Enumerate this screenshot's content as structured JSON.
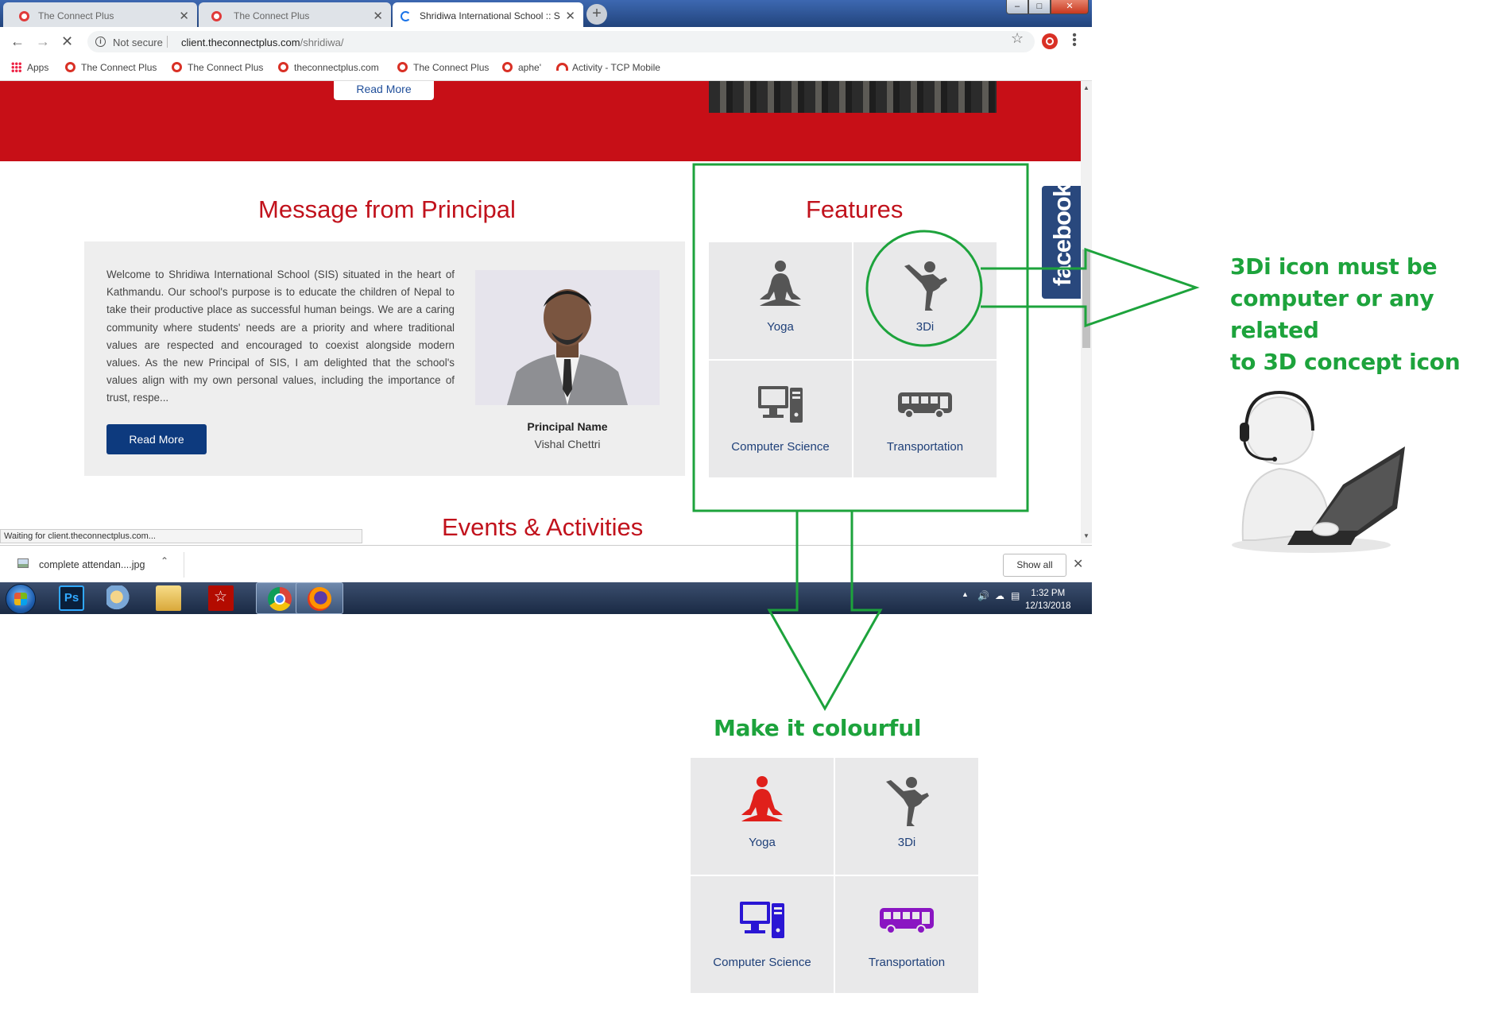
{
  "browser": {
    "tabs": [
      {
        "title": "The Connect Plus",
        "active": false
      },
      {
        "title": "The Connect Plus",
        "active": false
      },
      {
        "title": "Shridiwa International School :: S",
        "active": true
      }
    ],
    "address": {
      "security": "Not secure",
      "url_host": "client.theconnectplus.com",
      "url_path": "/shridiwa/"
    },
    "bookmarks": [
      {
        "label": "Apps",
        "icon": "apps-grid-icon"
      },
      {
        "label": "The Connect Plus",
        "icon": "connectplus-favicon"
      },
      {
        "label": "The Connect Plus",
        "icon": "connectplus-favicon"
      },
      {
        "label": "theconnectplus.com",
        "icon": "connectplus-favicon"
      },
      {
        "label": "The Connect Plus",
        "icon": "connectplus-favicon"
      },
      {
        "label": "aphe'",
        "icon": "connectplus-favicon"
      },
      {
        "label": "Activity - TCP Mobile",
        "icon": "tcp-mobile-icon"
      }
    ],
    "status": "Waiting for client.theconnectplus.com...",
    "download": {
      "file": "complete attendan....jpg",
      "show_all": "Show all"
    }
  },
  "page": {
    "top_read_more": "Read More",
    "principal": {
      "title": "Message from Principal",
      "body": "Welcome to Shridiwa International School (SIS) situated in the heart of Kathmandu. Our school's purpose is to educate the children of Nepal to take their productive place as successful human beings. We are a caring community where students' needs are a priority and where traditional values are respected and encouraged to coexist alongside modern values. As the new Principal of SIS, I am delighted that the school's values align with my own personal values, including the importance of trust, respe...",
      "read_more": "Read More",
      "caption_title": "Principal Name",
      "caption_name": "Vishal Chettri"
    },
    "features": {
      "title": "Features",
      "items": [
        {
          "label": "Yoga",
          "icon": "yoga-icon"
        },
        {
          "label": "3Di",
          "icon": "karate-icon"
        },
        {
          "label": "Computer Science",
          "icon": "computer-icon"
        },
        {
          "label": "Transportation",
          "icon": "bus-icon"
        }
      ]
    },
    "events_title": "Events & Activities",
    "facebook_tab": "facebook"
  },
  "taskbar": {
    "time": "1:32 PM",
    "date": "12/13/2018",
    "ps_label": "Ps"
  },
  "annotations": {
    "note_3di": "3Di icon must be computer or any related to 3D concept icon",
    "note_3di_lines": [
      "3Di icon must be",
      "computer or any related",
      "to 3D concept icon"
    ],
    "note_colour": "Make it colourful",
    "mockup_items": [
      {
        "label": "Yoga",
        "icon": "yoga-icon",
        "color": "#e0201b"
      },
      {
        "label": "3Di",
        "icon": "karate-icon",
        "color": "#555555"
      },
      {
        "label": "Computer Science",
        "icon": "computer-icon",
        "color": "#2a16d4"
      },
      {
        "label": "Transportation",
        "icon": "bus-icon",
        "color": "#8a15c2"
      }
    ],
    "annotation_color": "#1da33c"
  },
  "colors": {
    "brand_red": "#c70f17",
    "nav_blue": "#0d3a7e",
    "feature_label": "#1f4079",
    "icon_gray": "#555555"
  }
}
